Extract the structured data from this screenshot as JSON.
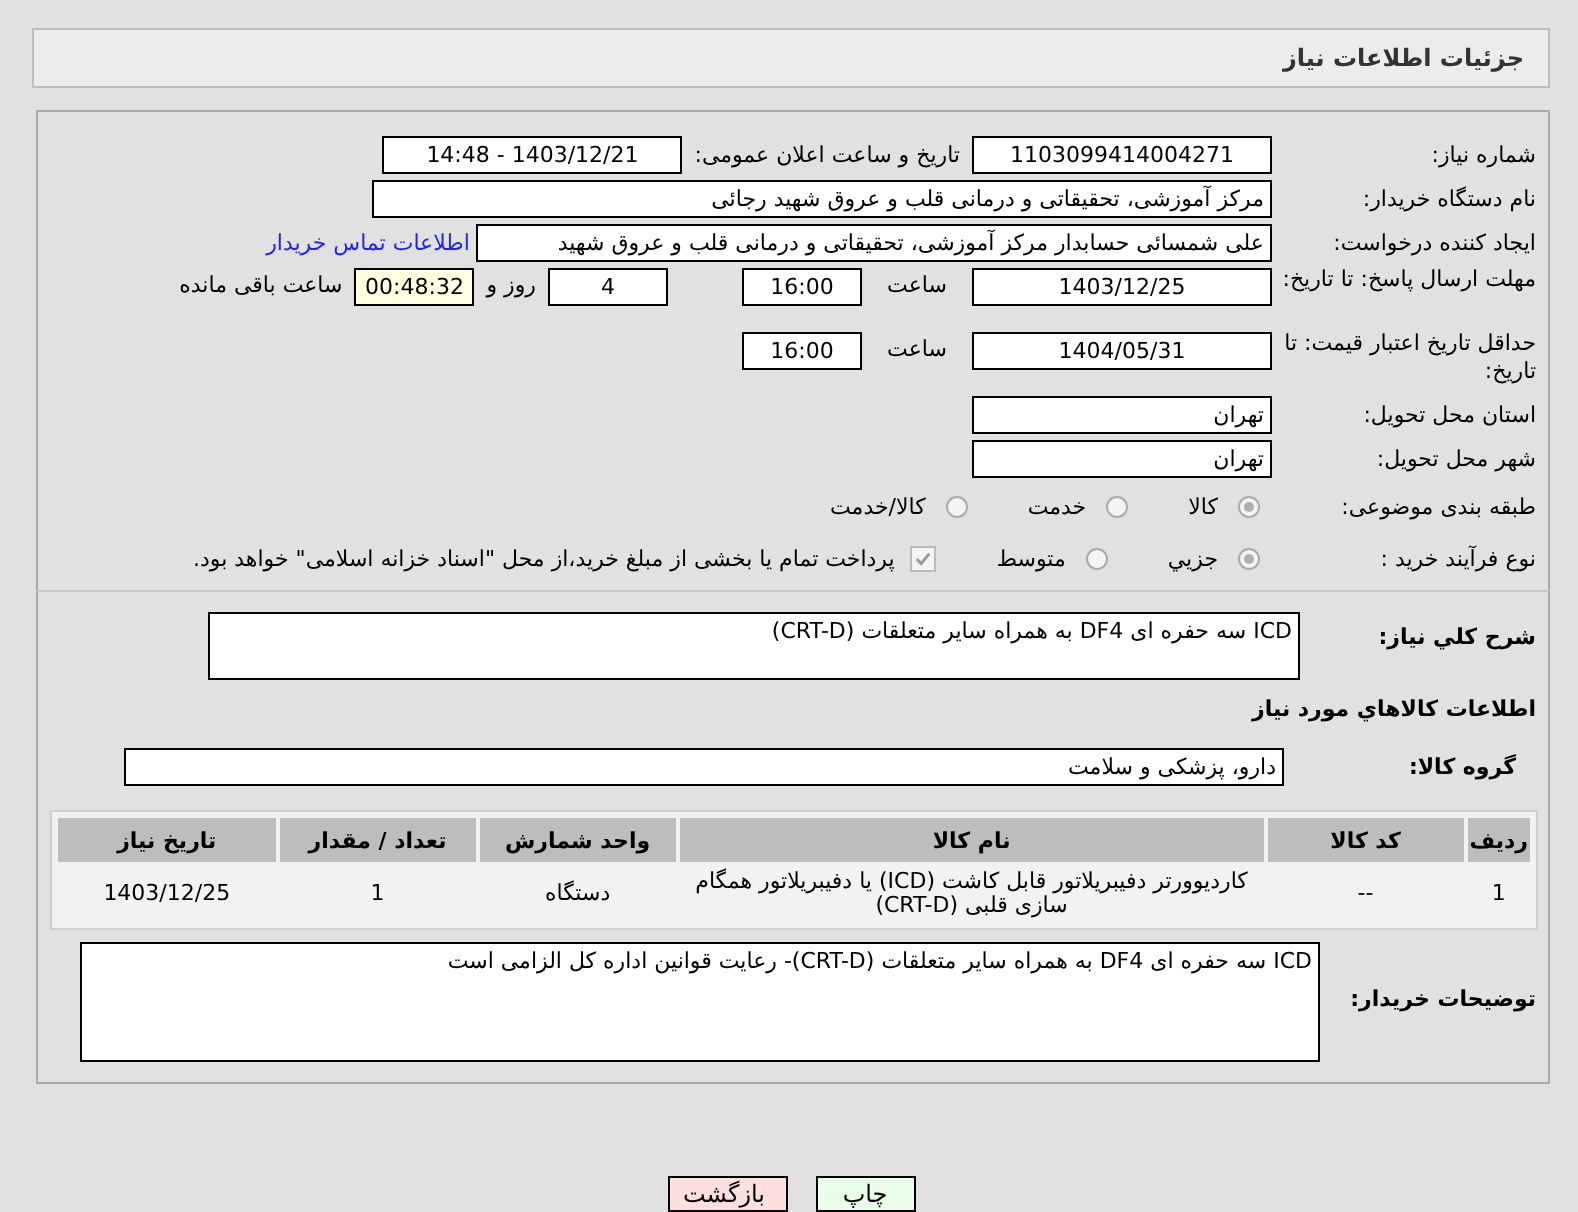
{
  "header": {
    "title": "جزئیات اطلاعات نیاز"
  },
  "need_number": {
    "label": "شماره نیاز:",
    "value": "1103099414004271"
  },
  "announce": {
    "label": "تاریخ و ساعت اعلان عمومی:",
    "value": "1403/12/21 - 14:48"
  },
  "buyer": {
    "label": "نام دستگاه خریدار:",
    "value": "مرکز آموزشی، تحقیقاتی و درمانی قلب و عروق شهید رجائی"
  },
  "creator": {
    "label": "ایجاد کننده درخواست:",
    "value": "علی شمسائی حسابدار مرکز آموزشی، تحقیقاتی و درمانی قلب و عروق شهید",
    "link": "اطلاعات تماس خریدار"
  },
  "deadline": {
    "label": "مهلت ارسال پاسخ: تا تاریخ:",
    "date": "1403/12/25",
    "time_label": "ساعت",
    "time": "16:00",
    "days": "4",
    "days_label": "روز و",
    "remaining": "00:48:32",
    "remaining_label": "ساعت باقی مانده"
  },
  "validity": {
    "label": "حداقل تاریخ اعتبار قیمت: تا تاریخ:",
    "date": "1404/05/31",
    "time_label": "ساعت",
    "time": "16:00"
  },
  "province": {
    "label": "استان محل تحویل:",
    "value": "تهران"
  },
  "city": {
    "label": "شهر محل تحویل:",
    "value": "تهران"
  },
  "category": {
    "label": "طبقه بندی موضوعی:",
    "options": [
      {
        "label": "کالا",
        "selected": true
      },
      {
        "label": "خدمت",
        "selected": false
      },
      {
        "label": "کالا/خدمت",
        "selected": false
      }
    ]
  },
  "process": {
    "label": "نوع فرآیند خرید :",
    "options": [
      {
        "label": "جزیي",
        "selected": true
      },
      {
        "label": "متوسط",
        "selected": false
      }
    ],
    "payment": {
      "label": "پرداخت تمام یا بخشی از مبلغ خرید،از محل \"اسناد خزانه اسلامی\" خواهد بود.",
      "checked": true
    }
  },
  "description": {
    "label": "شرح کلي نياز:",
    "value": "ICD سه حفره ای DF4 به همراه سایر متعلقات (CRT-D)"
  },
  "goods_title": "اطلاعات كالاهاي مورد نياز",
  "goods_group": {
    "label": "گروه کالا:",
    "value": "دارو، پزشکی و سلامت"
  },
  "table": {
    "columns": [
      "ردیف",
      "کد کالا",
      "نام کالا",
      "واحد شمارش",
      "تعداد / مقدار",
      "تاریخ نیاز"
    ],
    "rows": [
      [
        "1",
        "--",
        "کاردیوورتر دفیبریلاتور قابل کاشت (ICD) یا دفیبریلاتور همگام سازی قلبی (CRT-D)",
        "دستگاه",
        "1",
        "1403/12/25"
      ]
    ]
  },
  "buyer_notes": {
    "label": "توضیحات خریدار:",
    "value": "ICD سه حفره ای DF4 به همراه سایر متعلقات (CRT-D)- رعایت قوانین اداره کل الزامی است"
  },
  "buttons": [
    {
      "label": "چاپ",
      "kind": "print"
    },
    {
      "label": "بازگشت",
      "kind": "back"
    }
  ]
}
